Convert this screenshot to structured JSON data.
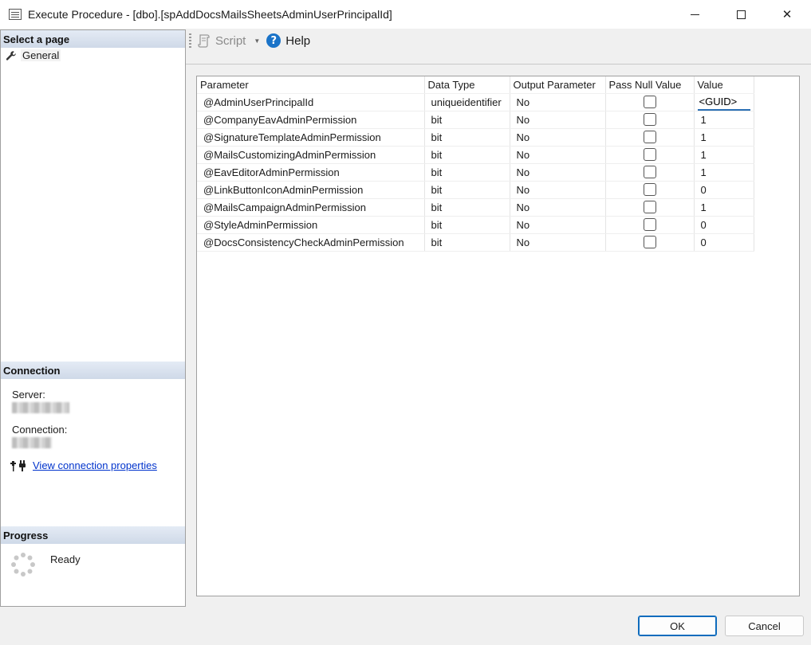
{
  "window": {
    "title": "Execute Procedure - [dbo].[spAddDocsMailsSheetsAdminUserPrincipalId]"
  },
  "left": {
    "select_page_header": "Select a page",
    "pages": [
      {
        "label": "General",
        "icon": "wrench-icon"
      }
    ],
    "connection_header": "Connection",
    "server_label": "Server:",
    "connection_label": "Connection:",
    "view_connection_link": "View connection properties",
    "progress_header": "Progress",
    "progress_status": "Ready"
  },
  "toolbar": {
    "script_label": "Script",
    "help_label": "Help"
  },
  "grid": {
    "columns": [
      "Parameter",
      "Data Type",
      "Output Parameter",
      "Pass Null Value",
      "Value"
    ],
    "rows": [
      {
        "parameter": "@AdminUserPrincipalId",
        "type": "uniqueidentifier",
        "output": "No",
        "pass_null": false,
        "value": "<GUID>"
      },
      {
        "parameter": "@CompanyEavAdminPermission",
        "type": "bit",
        "output": "No",
        "pass_null": false,
        "value": "1"
      },
      {
        "parameter": "@SignatureTemplateAdminPermission",
        "type": "bit",
        "output": "No",
        "pass_null": false,
        "value": "1"
      },
      {
        "parameter": "@MailsCustomizingAdminPermission",
        "type": "bit",
        "output": "No",
        "pass_null": false,
        "value": "1"
      },
      {
        "parameter": "@EavEditorAdminPermission",
        "type": "bit",
        "output": "No",
        "pass_null": false,
        "value": "1"
      },
      {
        "parameter": "@LinkButtonIconAdminPermission",
        "type": "bit",
        "output": "No",
        "pass_null": false,
        "value": "0"
      },
      {
        "parameter": "@MailsCampaignAdminPermission",
        "type": "bit",
        "output": "No",
        "pass_null": false,
        "value": "1"
      },
      {
        "parameter": "@StyleAdminPermission",
        "type": "bit",
        "output": "No",
        "pass_null": false,
        "value": "0"
      },
      {
        "parameter": "@DocsConsistencyCheckAdminPermission",
        "type": "bit",
        "output": "No",
        "pass_null": false,
        "value": "0"
      }
    ]
  },
  "buttons": {
    "ok": "OK",
    "cancel": "Cancel"
  },
  "colors": {
    "link": "#0033cc",
    "accent": "#0f6cbd",
    "section_header": "#cfd9e8"
  }
}
